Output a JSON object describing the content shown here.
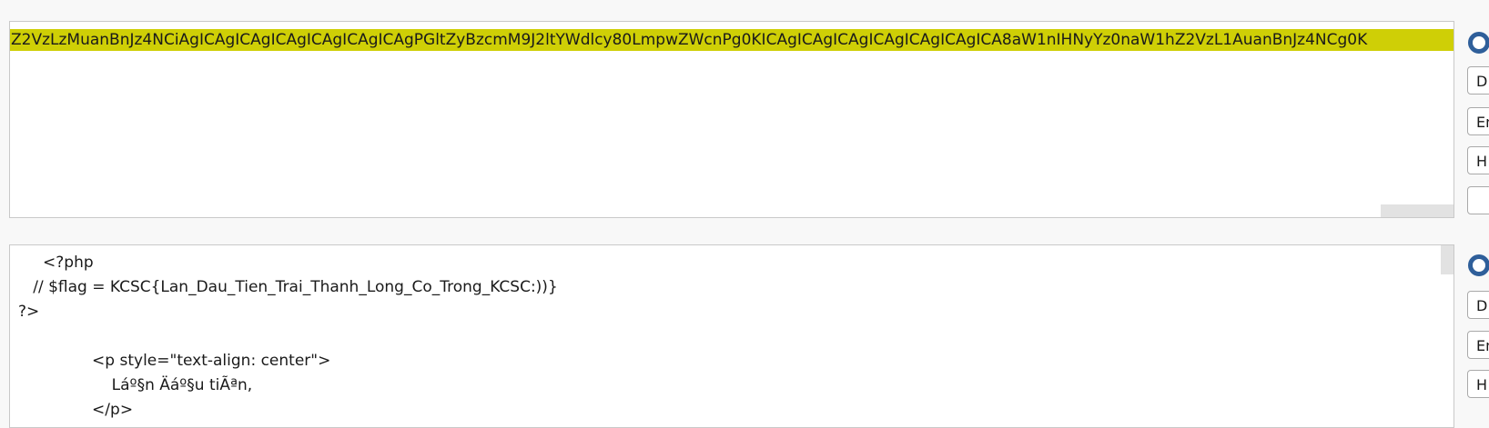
{
  "top_panel": {
    "encoded_text": "Z2VzLzMuanBnJz4NCiAgICAgICAgICAgICAgICAgICAgPGltZyBzcmM9J2ltYWdlcy80LmpwZWcnPg0KICAgICAgICAgICAgICAgICAgICA8aW1nIHNyYz0naW1hZ2VzL1AuanBnJz4NCg0K",
    "highlight_color": "#cfcf06"
  },
  "top_controls": {
    "radio": "radio-selected",
    "buttons": [
      "D",
      "En",
      "H",
      ""
    ]
  },
  "bottom_panel": {
    "lines": [
      "     <?php",
      "   // $flag = KCSC{Lan_Dau_Tien_Trai_Thanh_Long_Co_Trong_KCSC:))}",
      "?>",
      "",
      "               <p style=\"text-align: center\">",
      "                   Láº§n Äáº§u tiÃªn,",
      "               </p>"
    ]
  },
  "bottom_controls": {
    "radio": "radio-selected",
    "buttons": [
      "D",
      "En",
      "H"
    ]
  }
}
